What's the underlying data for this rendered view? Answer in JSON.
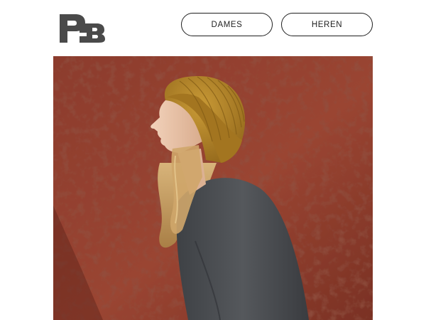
{
  "brand": {
    "logo_text": "PB",
    "logo_icon": "pb-monogram-logo"
  },
  "nav": {
    "dames_label": "DAMES",
    "heren_label": "HEREN"
  },
  "colors": {
    "wall": "#8a3a2c",
    "beanie": "#b3862a",
    "sweater": "#4b4e52",
    "hair": "#c9a36a",
    "skin": "#e8c3a8",
    "button_border": "#1f1f1f",
    "logo": "#4a4a4a"
  },
  "hero": {
    "image": "hero-photo-woman-in-beanie"
  }
}
